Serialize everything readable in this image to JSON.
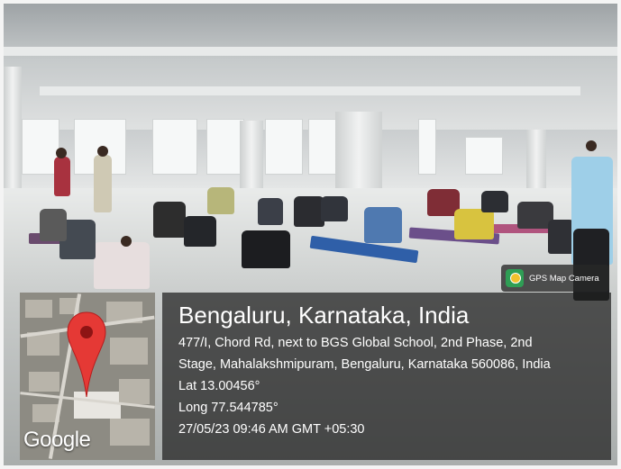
{
  "overlay": {
    "badge": {
      "app_name": "GPS Map Camera",
      "icon": "gps-map-camera-icon"
    },
    "location_title": "Bengaluru, Karnataka, India",
    "address_line_1": "477/I, Chord Rd, next to BGS Global School, 2nd Phase, 2nd",
    "address_line_2": "Stage, Mahalakshmipuram, Bengaluru, Karnataka 560086, India",
    "latitude": "Lat 13.00456°",
    "longitude": "Long 77.544785°",
    "datetime": "27/05/23 09:46 AM GMT +05:30",
    "map": {
      "logo_text": "Google",
      "pin_icon": "map-pin-icon",
      "pin_color": "#e53935"
    }
  },
  "colors": {
    "overlay_bg": "#1e1e1e",
    "text": "#ffffff",
    "badge_green": "#2f9e55"
  }
}
